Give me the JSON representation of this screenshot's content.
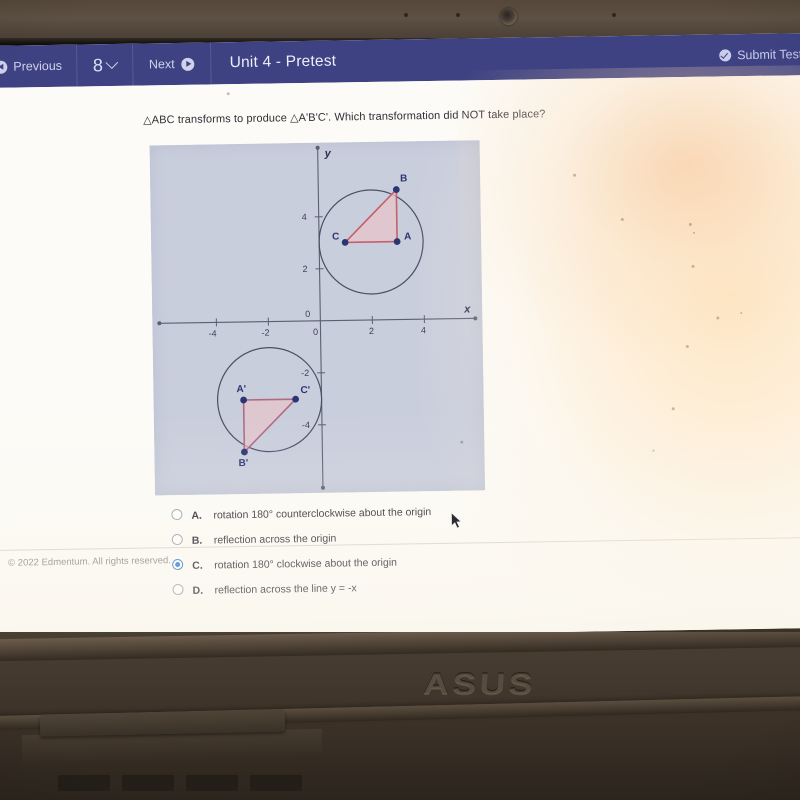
{
  "nav": {
    "previous_label": "Previous",
    "question_number": "8",
    "next_label": "Next",
    "title": "Unit 4 - Pretest",
    "submit_label": "Submit Test"
  },
  "question": {
    "text": "△ABC transforms to produce △A'B'C'. Which transformation did NOT take place?"
  },
  "graph": {
    "x_axis_label": "x",
    "y_axis_label": "y",
    "x_ticks": [
      "-4",
      "-2",
      "0",
      "2",
      "4"
    ],
    "y_ticks": [
      "4",
      "2",
      "0",
      "-2",
      "-4"
    ],
    "origin_label": "0",
    "points": [
      {
        "label": "A",
        "x": 3,
        "y": 3
      },
      {
        "label": "B",
        "x": 3,
        "y": 5
      },
      {
        "label": "C",
        "x": 1,
        "y": 3
      },
      {
        "label": "A'",
        "x": -3,
        "y": -3
      },
      {
        "label": "C'",
        "x": -1,
        "y": -3
      },
      {
        "label": "B'",
        "x": -3,
        "y": -5
      }
    ],
    "circles": [
      {
        "cx": 2,
        "cy": 3,
        "r": 2
      },
      {
        "cx": -2,
        "cy": -3,
        "r": 2
      }
    ],
    "triangle_fill": "#e7c4c9",
    "triangle_stroke": "#c4606b",
    "point_color": "#2b3573",
    "axis_color": "#5b5f73",
    "plot_background": "#c9cedd"
  },
  "options": [
    {
      "letter": "A.",
      "text": "rotation 180° counterclockwise about the origin",
      "selected": false
    },
    {
      "letter": "B.",
      "text": "reflection across the origin",
      "selected": false
    },
    {
      "letter": "C.",
      "text": "rotation 180° clockwise about the origin",
      "selected": true
    },
    {
      "letter": "D.",
      "text": "reflection across the line y = -x",
      "selected": false
    }
  ],
  "footer": {
    "copyright": "© 2022 Edmentum. All rights reserved."
  },
  "hardware": {
    "brand": "ASUS"
  },
  "colors": {
    "navbar": "#3e4282",
    "accent_radio": "#2f7fd6",
    "page_background": "#fcfbf7"
  }
}
